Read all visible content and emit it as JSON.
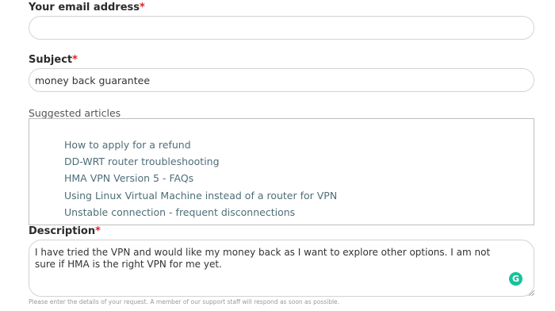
{
  "email": {
    "label": "Your email address",
    "required_mark": "*",
    "value": ""
  },
  "subject": {
    "label": "Subject",
    "required_mark": "*",
    "value": "money back guarantee"
  },
  "suggested": {
    "label": "Suggested articles",
    "items": [
      "How to apply for a refund",
      "DD-WRT router troubleshooting",
      "HMA VPN Version 5 - FAQs",
      "Using Linux Virtual Machine instead of a router for VPN",
      "Unstable connection - frequent disconnections"
    ]
  },
  "description": {
    "label": "Description",
    "required_mark": "*",
    "value": "I have tried the VPN and would like my money back as I want to explore other options. I am not sure if HMA is the right VPN for me yet.",
    "help": "Please enter the details of your request. A member of our support staff will respond as soon as possible."
  },
  "grammarly": {
    "glyph": "G",
    "color": "#15c39a"
  },
  "colors": {
    "required": "#d9252a",
    "link": "#4e6e78",
    "border": "#d3d3d3"
  }
}
